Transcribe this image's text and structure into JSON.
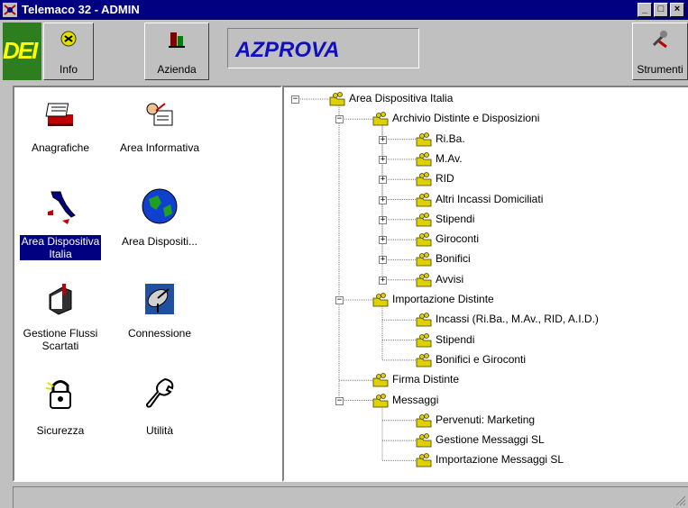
{
  "window": {
    "title": "Telemaco 32 - ADMIN"
  },
  "toolbar": {
    "logo_text": "DEI",
    "info_label": "Info",
    "azienda_label": "Azienda",
    "company_name": "AZPROVA",
    "strumenti_label": "Strumenti"
  },
  "left_panel": {
    "items": [
      {
        "label": "Anagrafiche"
      },
      {
        "label": "Area Informativa"
      },
      {
        "label": "Area Dispositiva Italia"
      },
      {
        "label": "Area Dispositi..."
      },
      {
        "label": "Gestione Flussi Scartati"
      },
      {
        "label": "Connessione"
      },
      {
        "label": "Sicurezza"
      },
      {
        "label": "Utilità"
      }
    ]
  },
  "tree": {
    "nodes": [
      {
        "label": "Area Dispositiva Italia",
        "level": 0,
        "toggle": "−"
      },
      {
        "label": "Archivio Distinte e Disposizioni",
        "level": 1,
        "toggle": "−"
      },
      {
        "label": "Ri.Ba.",
        "level": 2,
        "toggle": "+"
      },
      {
        "label": "M.Av.",
        "level": 2,
        "toggle": "+"
      },
      {
        "label": "RID",
        "level": 2,
        "toggle": "+"
      },
      {
        "label": "Altri Incassi Domiciliati",
        "level": 2,
        "toggle": "+"
      },
      {
        "label": "Stipendi",
        "level": 2,
        "toggle": "+"
      },
      {
        "label": "Giroconti",
        "level": 2,
        "toggle": "+"
      },
      {
        "label": "Bonifici",
        "level": 2,
        "toggle": "+"
      },
      {
        "label": "Avvisi",
        "level": 2,
        "toggle": "+"
      },
      {
        "label": "Importazione Distinte",
        "level": 1,
        "toggle": "−"
      },
      {
        "label": "Incassi (Ri.Ba., M.Av., RID, A.I.D.)",
        "level": 2,
        "toggle": ""
      },
      {
        "label": "Stipendi",
        "level": 2,
        "toggle": ""
      },
      {
        "label": "Bonifici e Giroconti",
        "level": 2,
        "toggle": ""
      },
      {
        "label": "Firma Distinte",
        "level": 1,
        "toggle": ""
      },
      {
        "label": "Messaggi",
        "level": 1,
        "toggle": "−"
      },
      {
        "label": "Pervenuti: Marketing",
        "level": 2,
        "toggle": ""
      },
      {
        "label": "Gestione Messaggi SL",
        "level": 2,
        "toggle": ""
      },
      {
        "label": "Importazione Messaggi SL",
        "level": 2,
        "toggle": ""
      }
    ]
  },
  "status": {
    "text": ""
  }
}
